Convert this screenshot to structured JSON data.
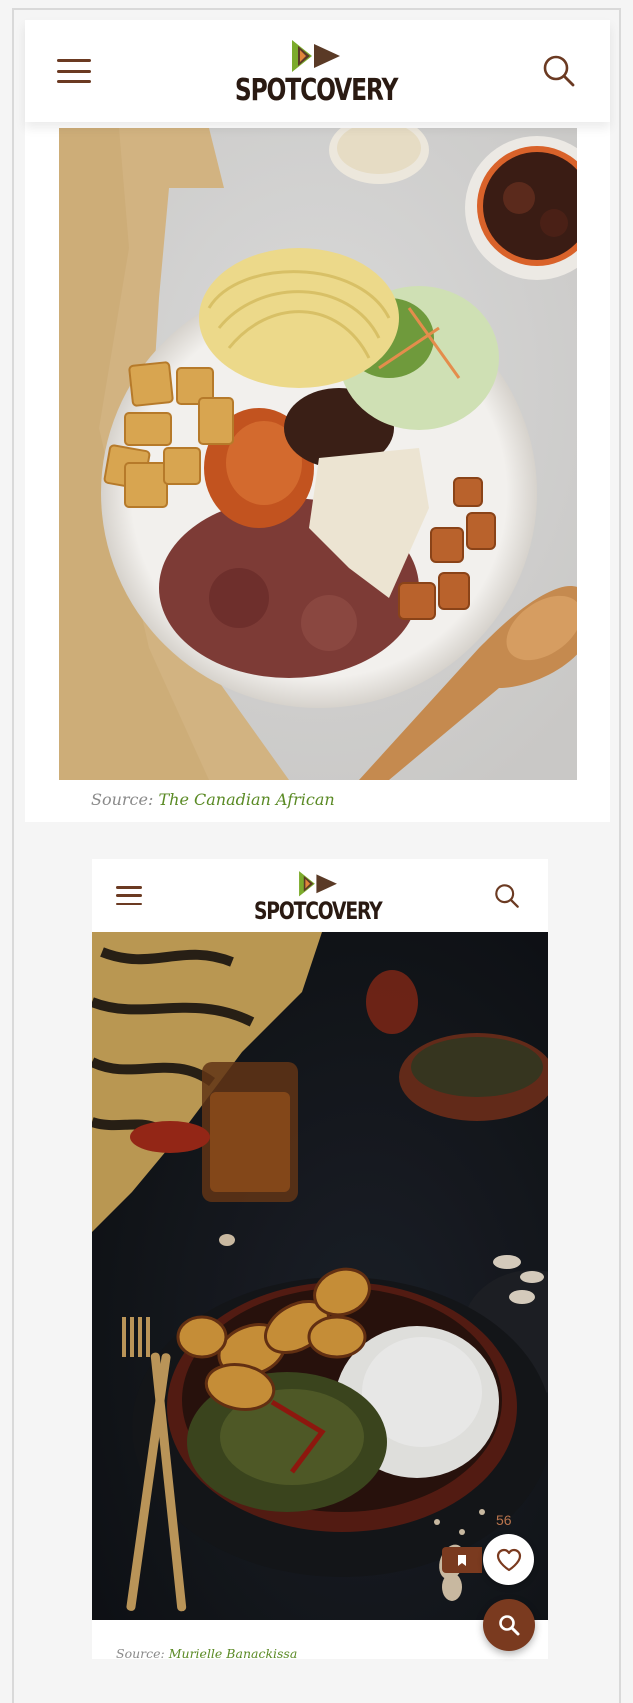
{
  "brand": {
    "name": "SPOTCOVERY",
    "colors": {
      "accent": "#6b3a22",
      "fab": "#7a3a1f",
      "logo_green": "#7cab2c",
      "logo_brown": "#5a3a26",
      "caption_link": "#5a8a24"
    }
  },
  "card1": {
    "header": {
      "menu_icon": "hamburger-icon",
      "search_icon": "search-icon"
    },
    "image_alt": "Bowl with spaghetti, fried tofu cubes, red beans and rice, tomato stew, slaw and grated cheese",
    "caption": {
      "prefix": "Source:",
      "source": "The Canadian African"
    }
  },
  "card2": {
    "header": {
      "menu_icon": "hamburger-icon",
      "search_icon": "search-icon"
    },
    "image_alt": "Dark bowl with fried plantains, leafy greens stew and white rice",
    "caption": {
      "prefix": "Source:",
      "source": "Murielle Banackissa"
    }
  },
  "floating": {
    "like_count": "56",
    "like_icon": "heart-icon",
    "bookmark_icon": "bookmark-icon",
    "search_fab_icon": "search-icon"
  }
}
